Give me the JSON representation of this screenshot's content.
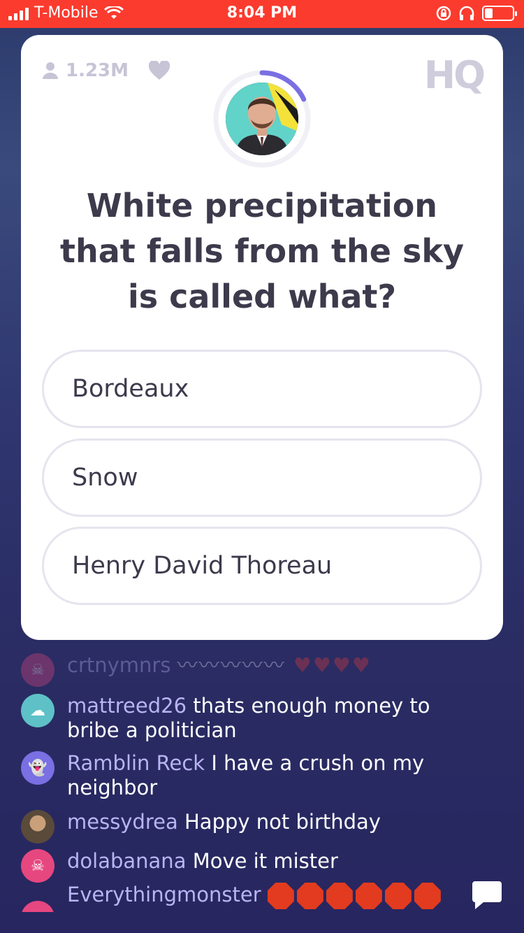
{
  "status_bar": {
    "carrier": "T-Mobile",
    "time": "8:04 PM",
    "battery_level": 0.3,
    "background": "#fb3b2e"
  },
  "card": {
    "viewer_count": "1.23M",
    "logo": "HQ",
    "question": "White precipitation that falls from the sky is called what?",
    "answers": [
      {
        "label": "Bordeaux"
      },
      {
        "label": "Snow"
      },
      {
        "label": "Henry David Thoreau"
      }
    ],
    "timer_progress": 0.18,
    "timer_color": "#7a6fe3"
  },
  "chat": [
    {
      "user": "crtnymnrs",
      "text": "",
      "avatar_color": "#e6477f",
      "avatar_icon": "skull-icon",
      "faded": true
    },
    {
      "user": "mattreed26",
      "text": "thats enough money to bribe a politician",
      "avatar_color": "#5ec1c7",
      "avatar_icon": "cloud-icon"
    },
    {
      "user": "Ramblin Reck",
      "text": "I have a crush on my neighbor",
      "avatar_color": "#7a6fe3",
      "avatar_icon": "ghost-icon"
    },
    {
      "user": "messydrea",
      "text": "Happy not birthday",
      "avatar_color": "#5a4a3a",
      "avatar_icon": "photo-avatar"
    },
    {
      "user": "dolabanana",
      "text": "Move it mister",
      "avatar_color": "#e6477f",
      "avatar_icon": "skull-icon"
    },
    {
      "user": "Everythingmonster",
      "text": "",
      "avatar_color": "#e6477f",
      "avatar_icon": "skull-icon"
    }
  ]
}
